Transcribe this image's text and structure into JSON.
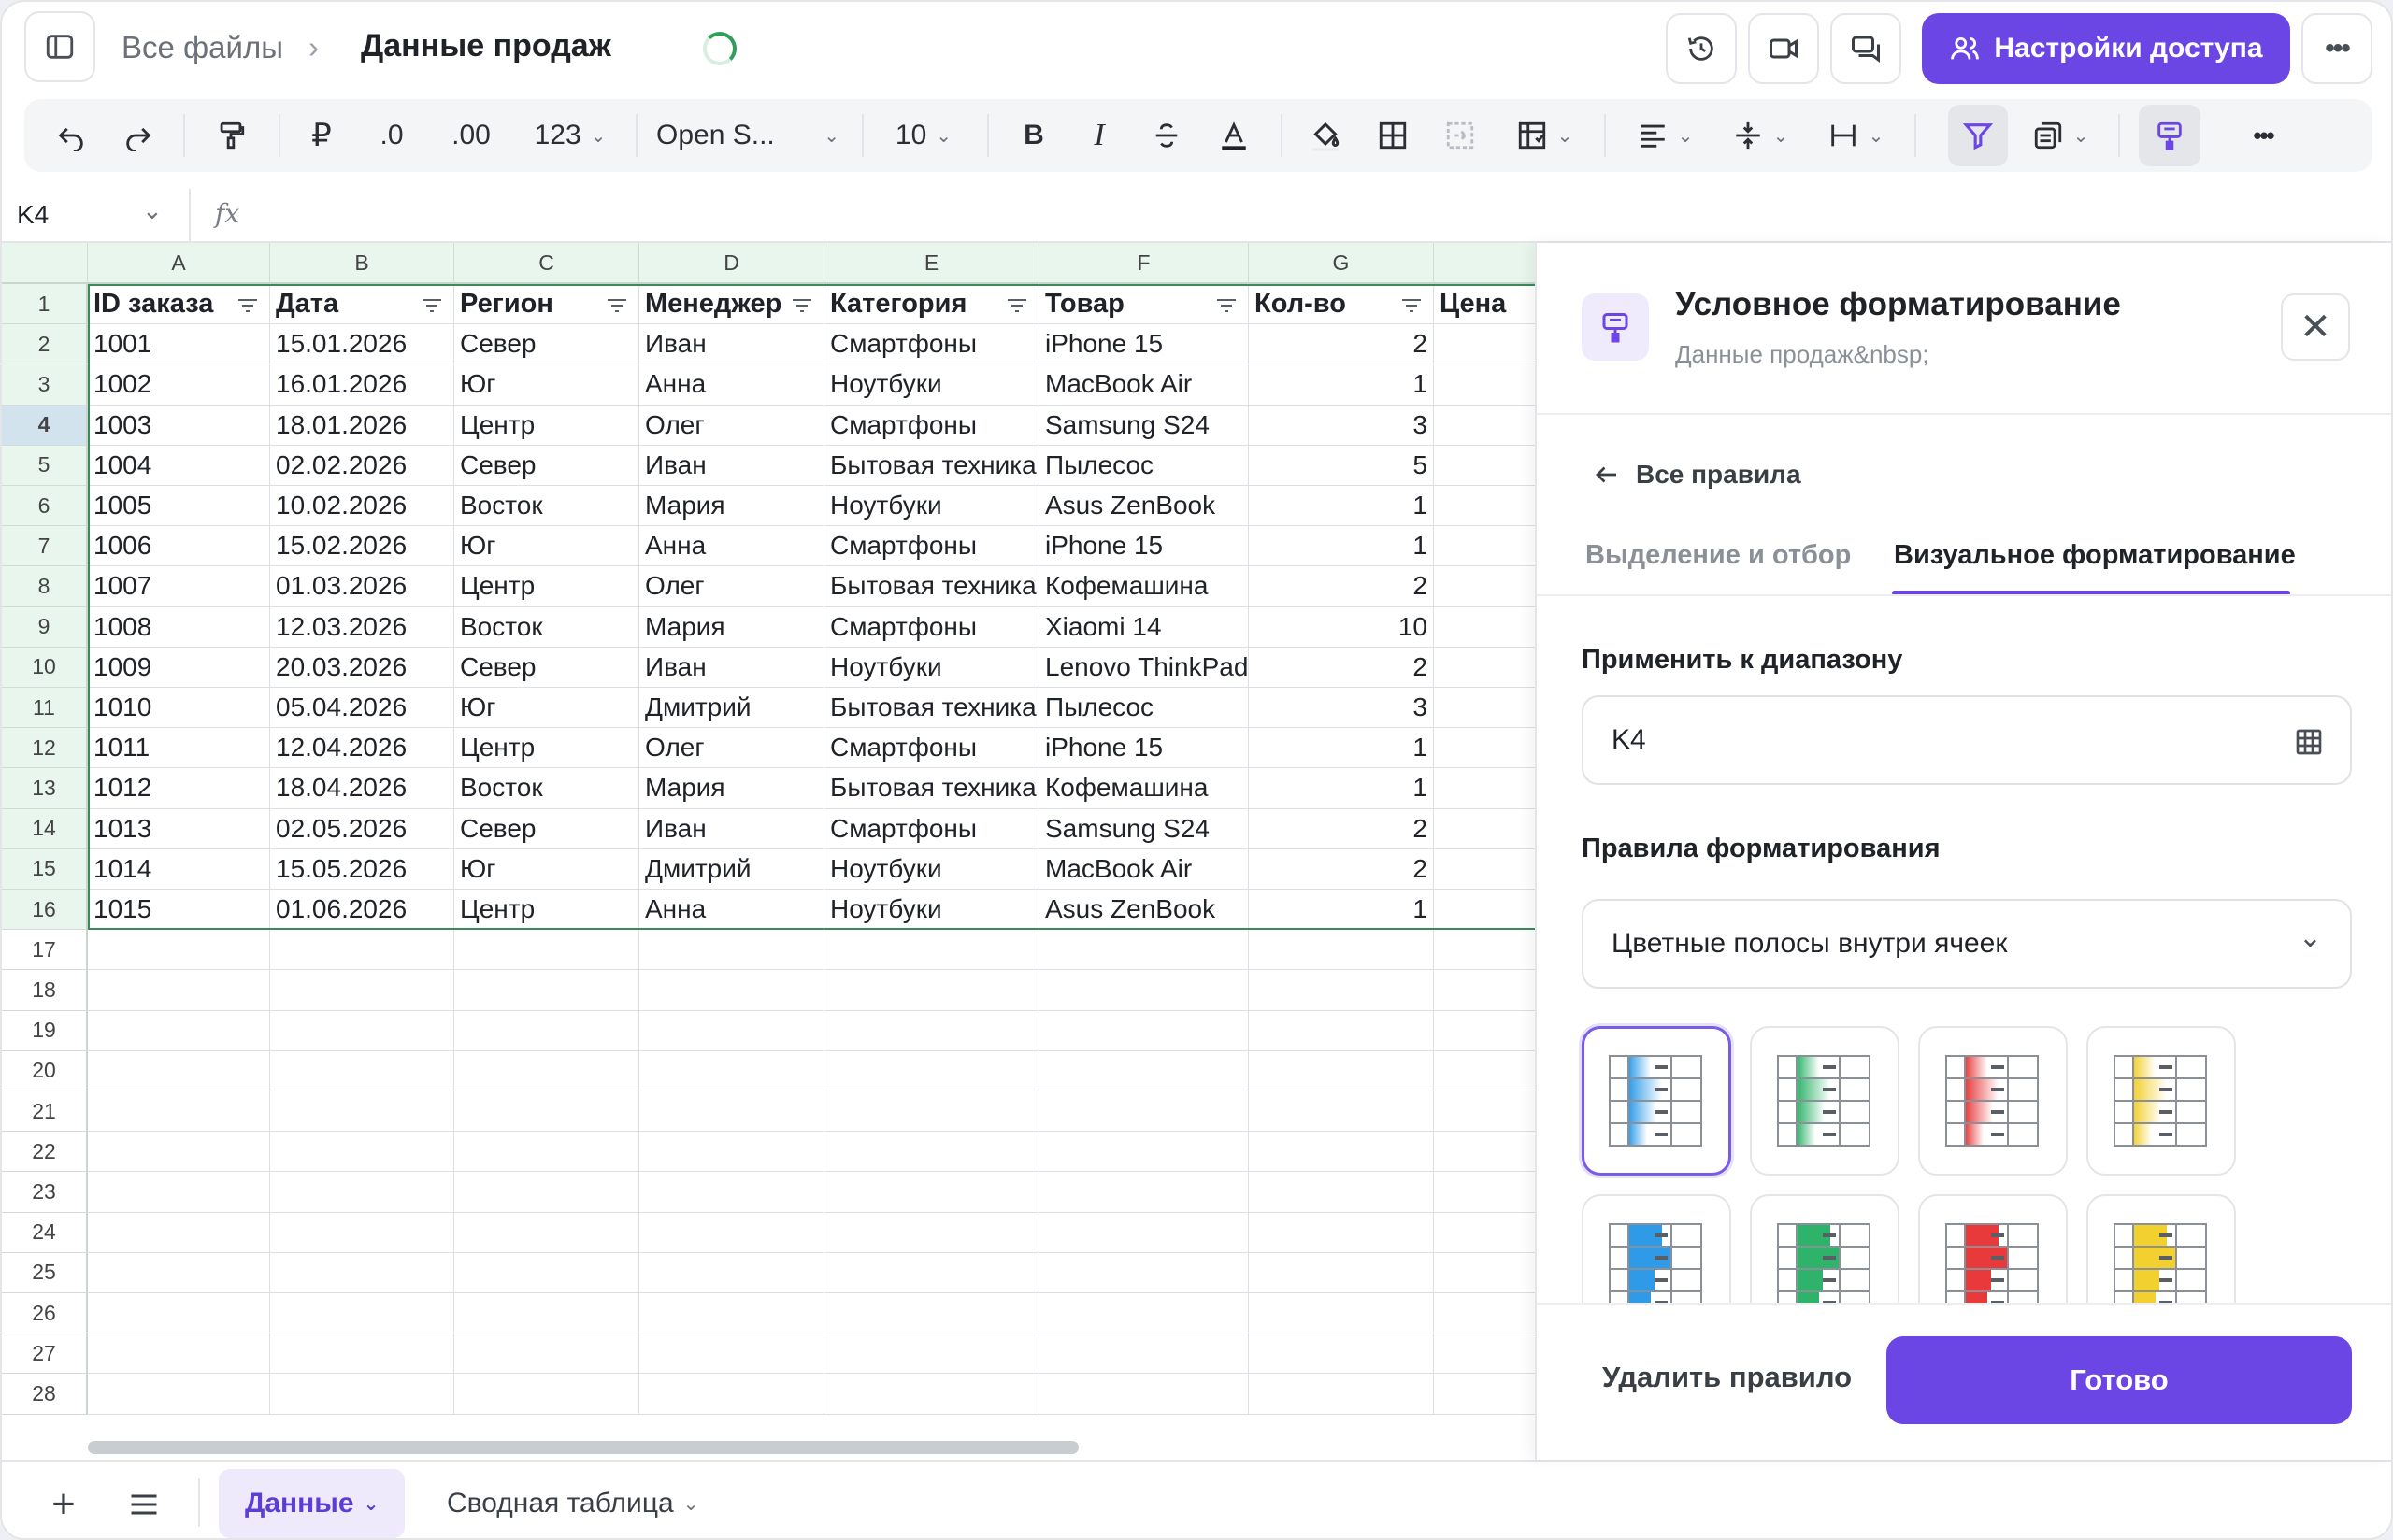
{
  "header": {
    "breadcrumb_root": "Все файлы",
    "breadcrumb_sep": "›",
    "file_title": "Данные продаж",
    "share_label": "Настройки доступа"
  },
  "toolbar": {
    "currency": "₽",
    "dec_less": ".0",
    "dec_more": ".00",
    "number_format": "123",
    "font_name": "Open S...",
    "font_size": "10",
    "bold": "B",
    "italic": "I"
  },
  "formula_bar": {
    "cell_ref": "K4",
    "fx_label": "fx",
    "value": ""
  },
  "grid": {
    "columns": [
      "A",
      "B",
      "C",
      "D",
      "E",
      "F",
      "G"
    ],
    "headers": [
      "ID заказа",
      "Дата",
      "Регион",
      "Менеджер",
      "Категория",
      "Товар",
      "Кол-во",
      "Цена"
    ],
    "rows": [
      [
        "1001",
        "15.01.2026",
        "Север",
        "Иван",
        "Смартфоны",
        "iPhone 15",
        "2"
      ],
      [
        "1002",
        "16.01.2026",
        "Юг",
        "Анна",
        "Ноутбуки",
        "MacBook Air",
        "1"
      ],
      [
        "1003",
        "18.01.2026",
        "Центр",
        "Олег",
        "Смартфоны",
        "Samsung S24",
        "3"
      ],
      [
        "1004",
        "02.02.2026",
        "Север",
        "Иван",
        "Бытовая техника",
        "Пылесос",
        "5"
      ],
      [
        "1005",
        "10.02.2026",
        "Восток",
        "Мария",
        "Ноутбуки",
        "Asus ZenBook",
        "1"
      ],
      [
        "1006",
        "15.02.2026",
        "Юг",
        "Анна",
        "Смартфоны",
        "iPhone 15",
        "1"
      ],
      [
        "1007",
        "01.03.2026",
        "Центр",
        "Олег",
        "Бытовая техника",
        "Кофемашина",
        "2"
      ],
      [
        "1008",
        "12.03.2026",
        "Восток",
        "Мария",
        "Смартфоны",
        "Xiaomi 14",
        "10"
      ],
      [
        "1009",
        "20.03.2026",
        "Север",
        "Иван",
        "Ноутбуки",
        "Lenovo ThinkPad",
        "2"
      ],
      [
        "1010",
        "05.04.2026",
        "Юг",
        "Дмитрий",
        "Бытовая техника",
        "Пылесос",
        "3"
      ],
      [
        "1011",
        "12.04.2026",
        "Центр",
        "Олег",
        "Смартфоны",
        "iPhone 15",
        "1"
      ],
      [
        "1012",
        "18.04.2026",
        "Восток",
        "Мария",
        "Бытовая техника",
        "Кофемашина",
        "1"
      ],
      [
        "1013",
        "02.05.2026",
        "Север",
        "Иван",
        "Смартфоны",
        "Samsung S24",
        "2"
      ],
      [
        "1014",
        "15.05.2026",
        "Юг",
        "Дмитрий",
        "Ноутбуки",
        "MacBook Air",
        "2"
      ],
      [
        "1015",
        "01.06.2026",
        "Центр",
        "Анна",
        "Ноутбуки",
        "Asus ZenBook",
        "1"
      ]
    ],
    "row_numbers": [
      "1",
      "2",
      "3",
      "4",
      "5",
      "6",
      "7",
      "8",
      "9",
      "10",
      "11",
      "12",
      "13",
      "14",
      "15",
      "16",
      "17",
      "18",
      "19",
      "20",
      "21",
      "22",
      "23",
      "24",
      "25",
      "26",
      "27",
      "28"
    ],
    "selected_row": "4"
  },
  "sheets": {
    "tabs": [
      "Данные",
      "Сводная таблица"
    ],
    "active": "Данные"
  },
  "panel": {
    "title": "Условное форматирование",
    "subtitle": "Данные продаж&nbsp;",
    "back_label": "Все правила",
    "tab_select": "Выделение и отбор",
    "tab_visual": "Визуальное форматирование",
    "range_label": "Применить к диапазону",
    "range_value": "K4",
    "rules_label": "Правила форматирования",
    "rule_type": "Цветные полосы внутри ячеек",
    "swatch_colors": [
      "#2f9be8",
      "#2fb36a",
      "#e83a3a",
      "#f2d02f"
    ],
    "delete_label": "Удалить правило",
    "done_label": "Готово"
  },
  "colors": {
    "accent": "#6b46e5",
    "header_green": "#e8f6ed",
    "range_border": "#3c8a5a"
  }
}
